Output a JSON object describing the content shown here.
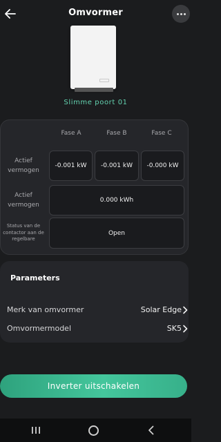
{
  "header": {
    "title": "Omvormer",
    "back_icon": "arrow-left-icon",
    "more_icon": "more-dots-icon"
  },
  "device": {
    "name": "Slimme poort 01",
    "image_icon": "inverter-device-image"
  },
  "phase_table": {
    "columns": [
      "Fase A",
      "Fase B",
      "Fase C"
    ],
    "rows": [
      {
        "label": "Actief vermogen",
        "values": [
          "-0.001 kW",
          "-0.001 kW",
          "-0.000 kW"
        ]
      },
      {
        "label": "Actief vermogen",
        "value": "0.000 kWh"
      },
      {
        "label": "Status van de contactor aan de regelbare",
        "value": "Open"
      }
    ]
  },
  "parameters": {
    "title": "Parameters",
    "items": [
      {
        "label": "Merk van omvormer",
        "value": "Solar Edge"
      },
      {
        "label": "Omvormermodel",
        "value": "SK5"
      }
    ]
  },
  "action": {
    "label": "Inverter uitschakelen",
    "color": "#3bb58e"
  },
  "colors": {
    "background": "#1b1c1e",
    "card": "#25262a",
    "accent": "#64d3b0"
  }
}
